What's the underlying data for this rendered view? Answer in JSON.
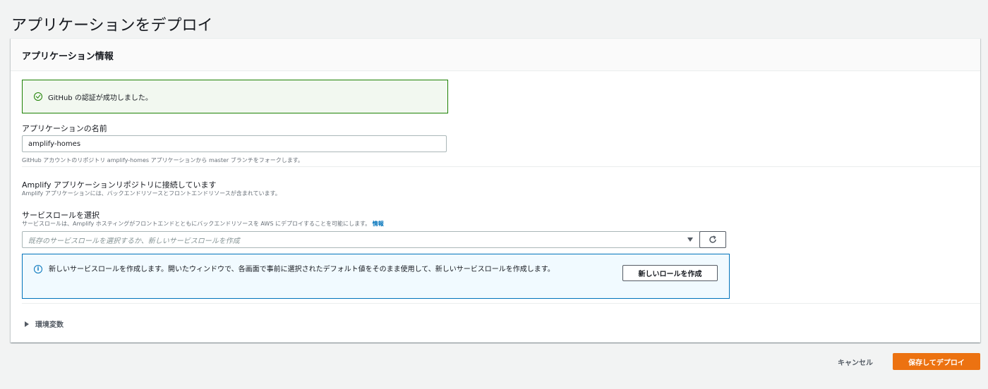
{
  "page": {
    "title": "アプリケーションをデプロイ"
  },
  "card": {
    "title": "アプリケーション情報",
    "success_message": "GitHub の認証が成功しました。",
    "app_name": {
      "label": "アプリケーションの名前",
      "value": "amplify-homes",
      "description": "GitHub アカウントのリポジトリ amplify-homes アプリケーションから master ブランチをフォークします。"
    },
    "repo": {
      "title": "Amplify アプリケーションリポジトリに接続しています",
      "description": "Amplify アプリケーションには、バックエンドリソースとフロントエンドリソースが含まれています。"
    },
    "service_role": {
      "label": "サービスロールを選択",
      "description": "サービスロールは、Amplify ホスティングがフロントエンドとともにバックエンドリソースを AWS にデプロイすることを可能にします。",
      "info_link": "情報",
      "placeholder": "既存のサービスロールを選択するか、新しいサービスロールを作成"
    },
    "info_box": {
      "text": "新しいサービスロールを作成します。開いたウィンドウで、各画面で事前に選択されたデフォルト値をそのまま使用して、新しいサービスロールを作成します。",
      "button_label": "新しいロールを作成"
    },
    "env_vars": {
      "label": "環境変数"
    }
  },
  "footer": {
    "cancel_label": "キャンセル",
    "deploy_label": "保存してデプロイ"
  },
  "colors": {
    "success": "#1d8102",
    "info": "#0073bb",
    "primary_button": "#ec7211"
  },
  "icons": [
    "check-circle-icon",
    "caret-down-icon",
    "refresh-icon",
    "info-icon",
    "expand-triangle-icon"
  ]
}
